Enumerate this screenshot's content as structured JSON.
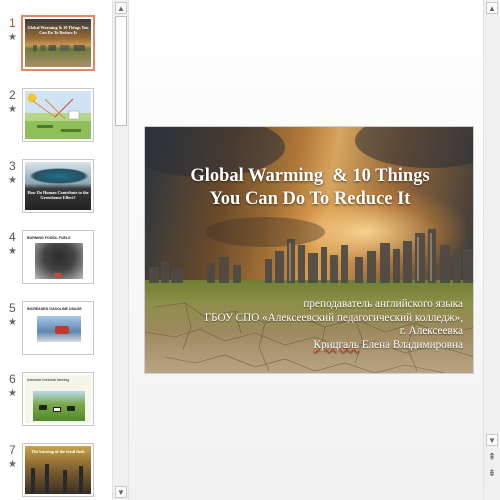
{
  "slides_panel": {
    "items": [
      {
        "number": "1",
        "active": true
      },
      {
        "number": "2",
        "active": false
      },
      {
        "number": "3",
        "active": false
      },
      {
        "number": "4",
        "active": false
      },
      {
        "number": "5",
        "active": false
      },
      {
        "number": "6",
        "active": false
      },
      {
        "number": "7",
        "active": false
      }
    ],
    "star": "★"
  },
  "thumbnails": {
    "t1_title": "Global Warming & 10 Things You Can Do To Reduce It",
    "t3_title": "How Do Human Contribute to the Greenhouse Effect?",
    "t4_title": "BURNING FOSSIL FUELS",
    "t5_title": "INCREASED GASOLINE USAGE",
    "t6_title": "Intensive livestock farming",
    "t7_title": "The burning of the fossil fuels"
  },
  "slide": {
    "title_line1": "Global Warming  & 10 Things",
    "title_line2": "You Can Do To Reduce It",
    "sub_line1": "преподаватель английского языка",
    "sub_line2": "ГБОУ СПО «Алексеевский педагогический колледж»,",
    "sub_line3": "г. Алексеевка",
    "sub_line4_a": "Крицгаль",
    "sub_line4_b": " Елена Владимировна"
  },
  "scrollbar": {
    "up": "▲",
    "down": "▼",
    "prev_slide": "⇞",
    "next_slide": "⇟"
  }
}
